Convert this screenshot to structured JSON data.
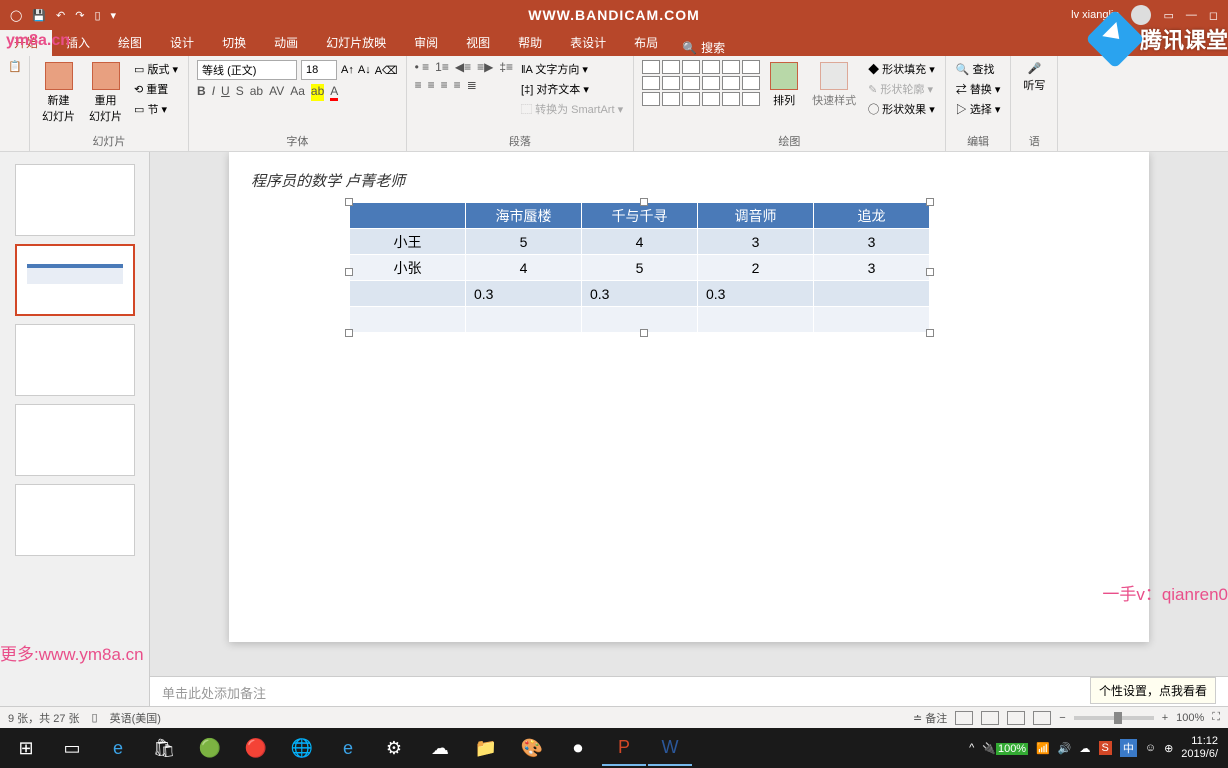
{
  "titlebar": {
    "center": "WWW.BANDICAM.COM",
    "user": "lv xianglin"
  },
  "tabs": {
    "start": "开始",
    "insert": "插入",
    "draw": "绘图",
    "design": "设计",
    "transition": "切换",
    "animation": "动画",
    "slideshow": "幻灯片放映",
    "review": "审阅",
    "view": "视图",
    "help": "帮助",
    "tabledesign": "表设计",
    "layout": "布局",
    "search": "搜索"
  },
  "ribbon": {
    "slides": {
      "label": "幻灯片",
      "new": "新建\n幻灯片",
      "reuse": "重用\n幻灯片",
      "layout": "版式",
      "reset": "重置",
      "section": "节"
    },
    "font": {
      "label": "字体",
      "name": "等线 (正文)",
      "size": "18"
    },
    "paragraph": {
      "label": "段落",
      "textdir": "文字方向",
      "align": "对齐文本",
      "smartart": "转换为 SmartArt"
    },
    "drawing": {
      "label": "绘图",
      "arrange": "排列",
      "quickstyle": "快速样式",
      "fill": "形状填充",
      "outline": "形状轮廓",
      "effects": "形状效果"
    },
    "editing": {
      "label": "编辑",
      "find": "查找",
      "replace": "替换",
      "select": "选择"
    },
    "voice": {
      "label": "语"
    }
  },
  "slide": {
    "title": "程序员的数学  卢菁老师",
    "notes_placeholder": "单击此处添加备注"
  },
  "chart_data": {
    "type": "table",
    "headers": [
      "",
      "海市蜃楼",
      "千与千寻",
      "调音师",
      "追龙"
    ],
    "rows": [
      {
        "label": "小王",
        "values": [
          "5",
          "4",
          "3",
          "3"
        ]
      },
      {
        "label": "小张",
        "values": [
          "4",
          "5",
          "2",
          "3"
        ]
      },
      {
        "label": "",
        "values": [
          "0.3",
          "0.3",
          "0.3",
          ""
        ]
      },
      {
        "label": "",
        "values": [
          "",
          "",
          "",
          ""
        ]
      }
    ]
  },
  "status": {
    "slide_info": "9 张，共 27 张",
    "lang": "英语(美国)",
    "notes": "备注",
    "zoom": "100%"
  },
  "tooltip": "个性设置，点我看看",
  "watermarks": {
    "w1": "ym8a.cn",
    "w2": "更多:www.ym8a.cn",
    "w3": "一手v：qianren0"
  },
  "tencent": "腾讯课堂",
  "taskbar": {
    "time": "11:12",
    "date": "2019/6/",
    "battery": "100%",
    "ime": "中"
  }
}
